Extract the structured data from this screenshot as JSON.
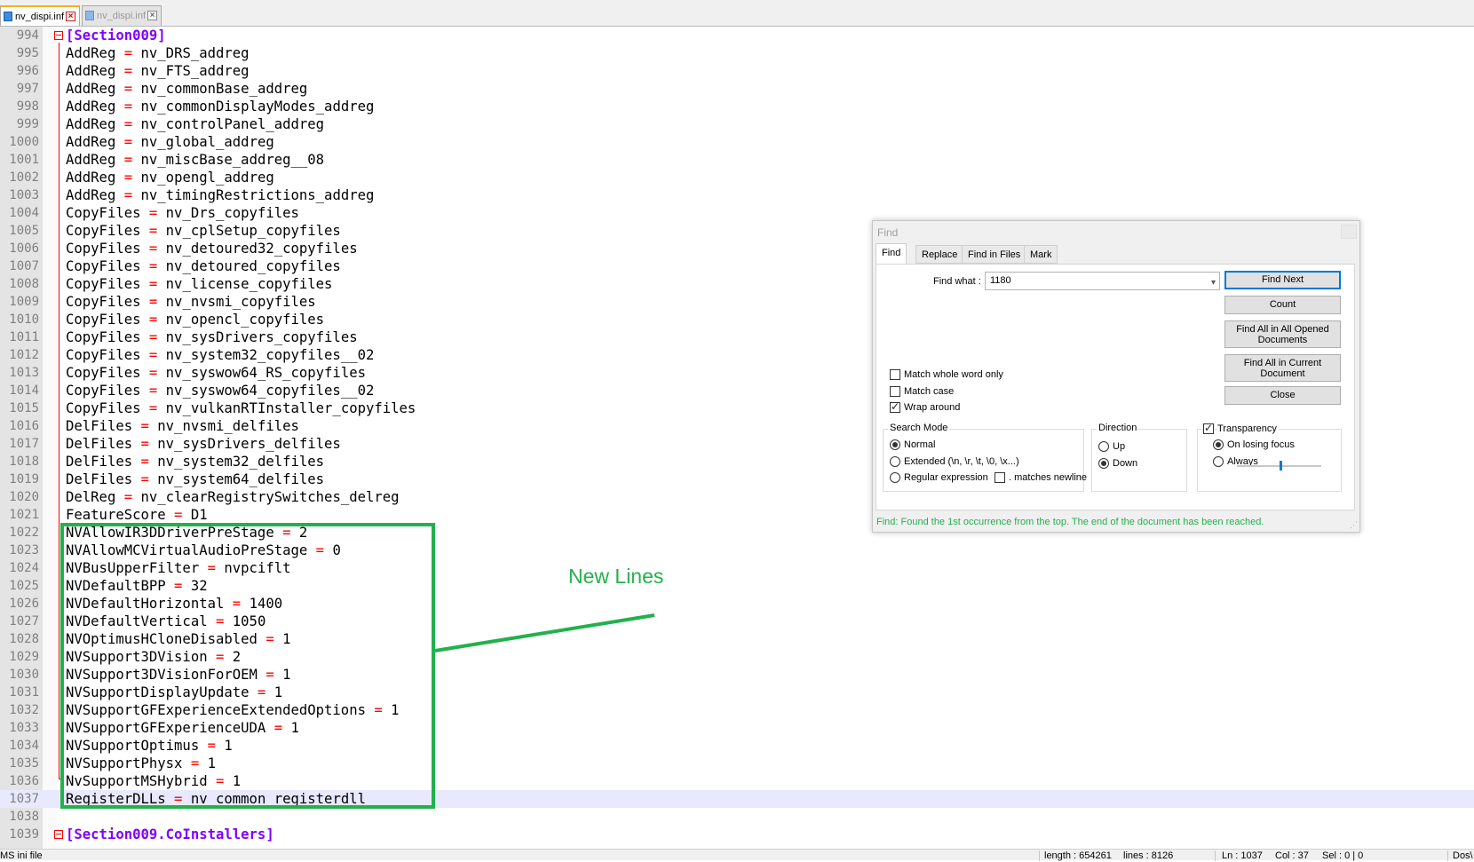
{
  "tabs": [
    {
      "label": "nv_dispi.inf",
      "active": true
    },
    {
      "label": "nv_dispi.inf",
      "active": false
    }
  ],
  "editor": {
    "current_line": "1037",
    "lines": [
      {
        "num": "994",
        "text": "[Section009]",
        "type": "section"
      },
      {
        "num": "995",
        "key": "AddReg",
        "value": "nv_DRS_addreg"
      },
      {
        "num": "996",
        "key": "AddReg",
        "value": "nv_FTS_addreg"
      },
      {
        "num": "997",
        "key": "AddReg",
        "value": "nv_commonBase_addreg"
      },
      {
        "num": "998",
        "key": "AddReg",
        "value": "nv_commonDisplayModes_addreg"
      },
      {
        "num": "999",
        "key": "AddReg",
        "value": "nv_controlPanel_addreg"
      },
      {
        "num": "1000",
        "key": "AddReg",
        "value": "nv_global_addreg"
      },
      {
        "num": "1001",
        "key": "AddReg",
        "value": "nv_miscBase_addreg__08"
      },
      {
        "num": "1002",
        "key": "AddReg",
        "value": "nv_opengl_addreg"
      },
      {
        "num": "1003",
        "key": "AddReg",
        "value": "nv_timingRestrictions_addreg"
      },
      {
        "num": "1004",
        "key": "CopyFiles",
        "value": "nv_Drs_copyfiles"
      },
      {
        "num": "1005",
        "key": "CopyFiles",
        "value": "nv_cplSetup_copyfiles"
      },
      {
        "num": "1006",
        "key": "CopyFiles",
        "value": "nv_detoured32_copyfiles"
      },
      {
        "num": "1007",
        "key": "CopyFiles",
        "value": "nv_detoured_copyfiles"
      },
      {
        "num": "1008",
        "key": "CopyFiles",
        "value": "nv_license_copyfiles"
      },
      {
        "num": "1009",
        "key": "CopyFiles",
        "value": "nv_nvsmi_copyfiles"
      },
      {
        "num": "1010",
        "key": "CopyFiles",
        "value": "nv_opencl_copyfiles"
      },
      {
        "num": "1011",
        "key": "CopyFiles",
        "value": "nv_sysDrivers_copyfiles"
      },
      {
        "num": "1012",
        "key": "CopyFiles",
        "value": "nv_system32_copyfiles__02"
      },
      {
        "num": "1013",
        "key": "CopyFiles",
        "value": "nv_syswow64_RS_copyfiles"
      },
      {
        "num": "1014",
        "key": "CopyFiles",
        "value": "nv_syswow64_copyfiles__02"
      },
      {
        "num": "1015",
        "key": "CopyFiles",
        "value": "nv_vulkanRTInstaller_copyfiles"
      },
      {
        "num": "1016",
        "key": "DelFiles",
        "value": "nv_nvsmi_delfiles"
      },
      {
        "num": "1017",
        "key": "DelFiles",
        "value": "nv_sysDrivers_delfiles"
      },
      {
        "num": "1018",
        "key": "DelFiles",
        "value": "nv_system32_delfiles"
      },
      {
        "num": "1019",
        "key": "DelFiles",
        "value": "nv_system64_delfiles"
      },
      {
        "num": "1020",
        "key": "DelReg",
        "value": "nv_clearRegistrySwitches_delreg"
      },
      {
        "num": "1021",
        "key": "FeatureScore",
        "value": "D1"
      },
      {
        "num": "1022",
        "key": "NVAllowIR3DDriverPreStage",
        "value": "2"
      },
      {
        "num": "1023",
        "key": "NVAllowMCVirtualAudioPreStage",
        "value": "0"
      },
      {
        "num": "1024",
        "key": "NVBusUpperFilter",
        "value": "nvpciflt"
      },
      {
        "num": "1025",
        "key": "NVDefaultBPP",
        "value": "32"
      },
      {
        "num": "1026",
        "key": "NVDefaultHorizontal",
        "value": "1400"
      },
      {
        "num": "1027",
        "key": "NVDefaultVertical",
        "value": "1050"
      },
      {
        "num": "1028",
        "key": "NVOptimusHCloneDisabled",
        "value": "1"
      },
      {
        "num": "1029",
        "key": "NVSupport3DVision",
        "value": "2"
      },
      {
        "num": "1030",
        "key": "NVSupport3DVisionForOEM",
        "value": "1"
      },
      {
        "num": "1031",
        "key": "NVSupportDisplayUpdate",
        "value": "1"
      },
      {
        "num": "1032",
        "key": "NVSupportGFExperienceExtendedOptions",
        "value": "1"
      },
      {
        "num": "1033",
        "key": "NVSupportGFExperienceUDA",
        "value": "1"
      },
      {
        "num": "1034",
        "key": "NVSupportOptimus",
        "value": "1"
      },
      {
        "num": "1035",
        "key": "NVSupportPhysx",
        "value": "1"
      },
      {
        "num": "1036",
        "key": "NvSupportMSHybrid",
        "value": "1"
      },
      {
        "num": "1037",
        "key": "RegisterDLLs",
        "value": "nv_common_registerdll"
      },
      {
        "num": "1038",
        "text": "",
        "type": "blank"
      },
      {
        "num": "1039",
        "text": "[Section009.CoInstallers]",
        "type": "section"
      }
    ]
  },
  "annotation": {
    "text": "New Lines",
    "color": "#22b14c"
  },
  "find_dialog": {
    "title": "Find",
    "tabs": [
      "Find",
      "Replace",
      "Find in Files",
      "Mark"
    ],
    "find_what_label": "Find what :",
    "find_what_value": "1180",
    "buttons": {
      "find_next": "Find Next",
      "count": "Count",
      "find_all_opened": "Find All in All Opened Documents",
      "find_all_current": "Find All in Current Document",
      "close": "Close"
    },
    "checkboxes": {
      "match_whole_word": {
        "label": "Match whole word only",
        "checked": false
      },
      "match_case": {
        "label": "Match case",
        "checked": false
      },
      "wrap_around": {
        "label": "Wrap around",
        "checked": true
      }
    },
    "search_mode": {
      "title": "Search Mode",
      "normal": "Normal",
      "extended": "Extended (\\n, \\r, \\t, \\0, \\x...)",
      "regex": "Regular expression",
      "matches_newline": ". matches newline",
      "selected": "normal"
    },
    "direction": {
      "title": "Direction",
      "up": "Up",
      "down": "Down",
      "selected": "down"
    },
    "transparency": {
      "label": "Transparency",
      "checked": true,
      "on_losing_focus": "On losing focus",
      "always": "Always",
      "selected": "on_losing_focus"
    },
    "status": "Find: Found the 1st occurrence from the top. The end of the document has been reached."
  },
  "statusbar": {
    "file_type": "MS ini file",
    "length": "length : 654261",
    "lines": "lines : 8126",
    "ln": "Ln : 1037",
    "col": "Col : 37",
    "sel": "Sel : 0 | 0",
    "eol": "Dos\\"
  }
}
